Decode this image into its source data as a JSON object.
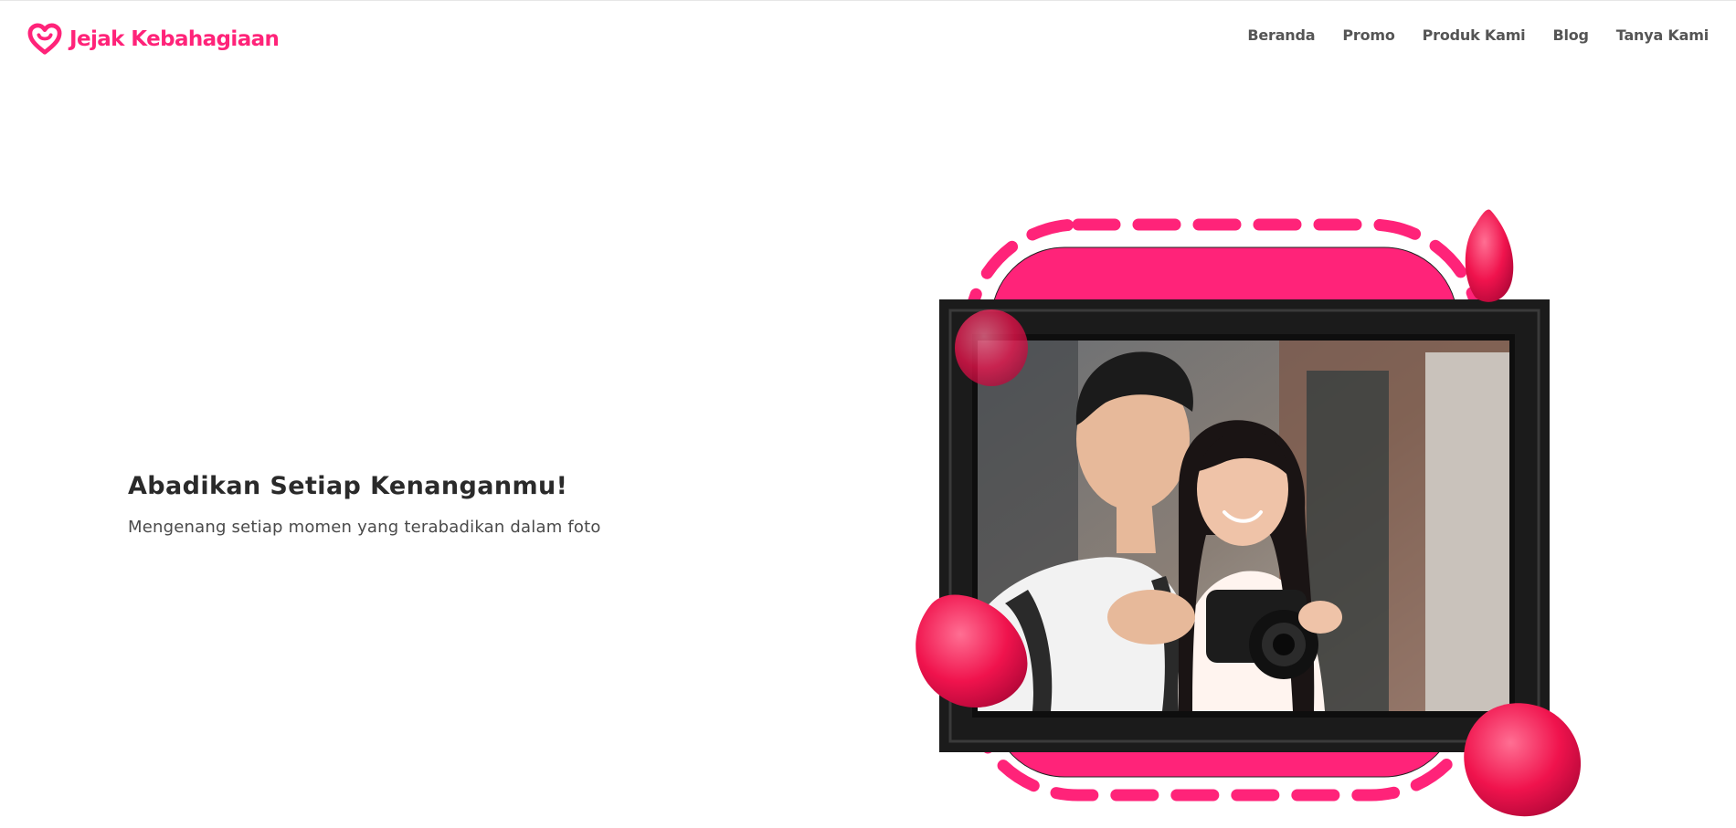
{
  "brand": {
    "name": "Jejak Kebahagiaan",
    "logo_icon": "heart-logo-icon",
    "accent_color": "#ff2379"
  },
  "nav": {
    "items": [
      {
        "label": "Beranda"
      },
      {
        "label": "Promo"
      },
      {
        "label": "Produk Kami"
      },
      {
        "label": "Blog"
      },
      {
        "label": "Tanya Kami"
      }
    ]
  },
  "hero": {
    "title": "Abadikan Setiap Kenanganmu!",
    "subtitle": "Mengenang setiap momen yang terabadikan dalam foto",
    "image": "couple-with-camera-photo",
    "decorations": [
      "rose-petal",
      "dashed-frame-outline",
      "pink-badge-background"
    ]
  }
}
